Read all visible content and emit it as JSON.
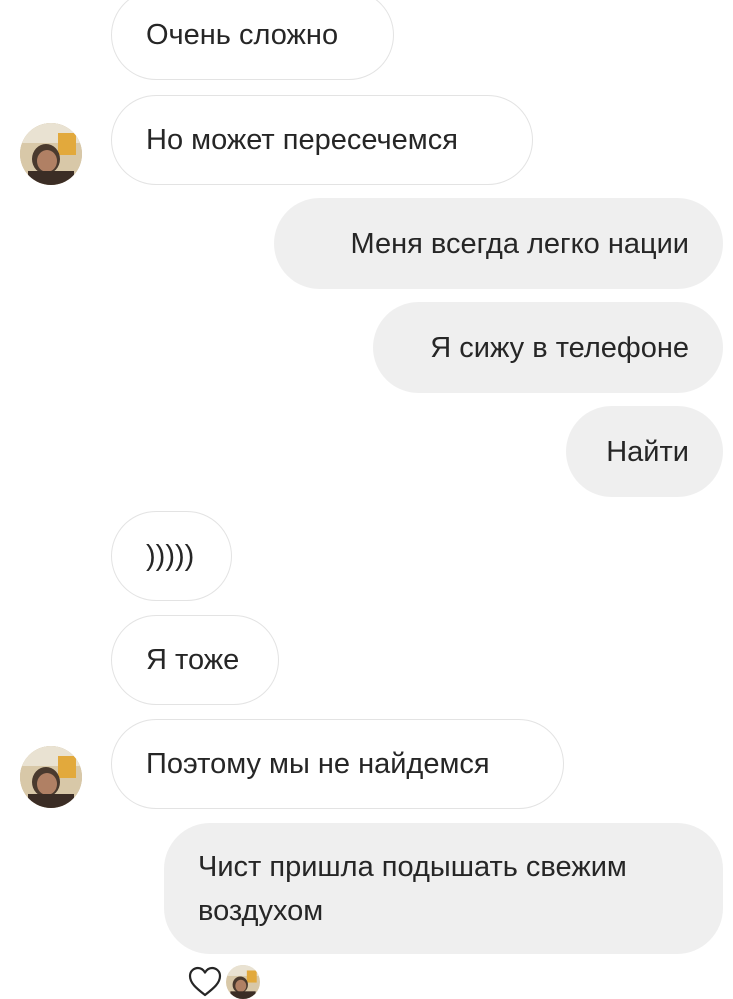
{
  "messages": [
    {
      "side": "incoming",
      "text": "Очень сложно"
    },
    {
      "side": "incoming",
      "text": "Но может пересечемся"
    },
    {
      "side": "outgoing",
      "text": "Меня всегда легко нации"
    },
    {
      "side": "outgoing",
      "text": "Я сижу в телефоне"
    },
    {
      "side": "outgoing",
      "text": "Найти"
    },
    {
      "side": "incoming",
      "text": ")))))"
    },
    {
      "side": "incoming",
      "text": "Я тоже"
    },
    {
      "side": "incoming",
      "text": "Поэтому мы не найдемся"
    },
    {
      "side": "outgoing",
      "text": "Чист пришла подышать свежим воздухом"
    }
  ],
  "icons": {
    "reaction": "heart-icon",
    "sender_avatar": "avatar"
  },
  "colors": {
    "incoming_bg": "#ffffff",
    "incoming_border": "#e3e3e3",
    "outgoing_bg": "#efefef",
    "text": "#262626"
  }
}
